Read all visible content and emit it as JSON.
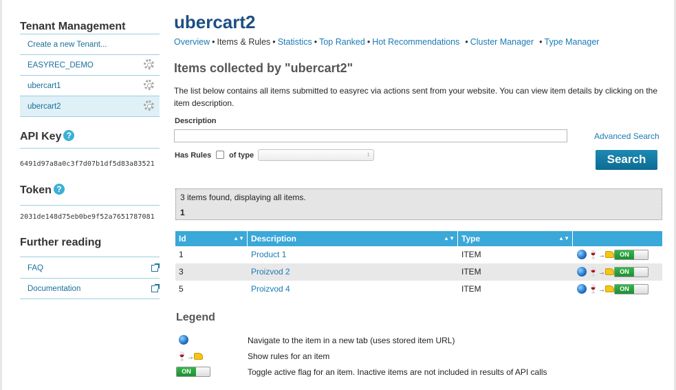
{
  "sidebar": {
    "tenant_heading": "Tenant Management",
    "create_link": "Create a new Tenant...",
    "tenants": [
      "EASYREC_DEMO",
      "ubercart1",
      "ubercart2"
    ],
    "api_key_heading": "API Key",
    "api_key": "6491d97a8a0c3f7d07b1df5d83a83521",
    "token_heading": "Token",
    "token": "2031de148d75eb0be9f52a7651787081",
    "help_glyph": "?",
    "further_heading": "Further reading",
    "links": [
      "FAQ",
      "Documentation"
    ]
  },
  "main": {
    "tenant_title": "ubercart2",
    "nav": {
      "overview": "Overview",
      "items_rules": "Items & Rules",
      "statistics": "Statistics",
      "top_ranked": "Top Ranked",
      "hot": "Hot Recommendations",
      "cluster": "Cluster Manager",
      "type_manager": "Type Manager",
      "separator": "•"
    },
    "heading": "Items collected by \"ubercart2\"",
    "intro": "The list below contains all items submitted to easyrec via actions sent from your website. You can view item details by clicking on the item description.",
    "description_label": "Description",
    "advanced_search": "Advanced Search",
    "has_rules_label": "Has Rules",
    "of_type_label": "of type",
    "search_button": "Search",
    "results_text": "3 items found, displaying all items.",
    "page_number": "1"
  },
  "table": {
    "columns": [
      "Id",
      "Description",
      "Type"
    ],
    "sort_glyph": "▲▼",
    "rows": [
      {
        "id": "1",
        "description": "Product 1",
        "type": "ITEM",
        "active": "ON"
      },
      {
        "id": "3",
        "description": "Proizvod 2",
        "type": "ITEM",
        "active": "ON"
      },
      {
        "id": "5",
        "description": "Proizvod 4",
        "type": "ITEM",
        "active": "ON"
      }
    ]
  },
  "legend": {
    "heading": "Legend",
    "navigate": "Navigate to the item in a new tab (uses stored item URL)",
    "rules": "Show rules for an item",
    "toggle": "Toggle active flag for an item. Inactive items are not included in results of API calls",
    "toggle_label": "ON"
  },
  "icons": {
    "gear": "gear-icon",
    "help": "help-icon",
    "external": "external-link-icon",
    "globe": "globe-icon",
    "rules": "wine-cheese-rules-icon",
    "toggle": "on-off-toggle"
  },
  "colors": {
    "accent": "#3aa8d8",
    "title": "#1c4f82",
    "link": "#1a7ab5",
    "button": "#0d6b93",
    "toggle_on": "#1f8e33"
  }
}
